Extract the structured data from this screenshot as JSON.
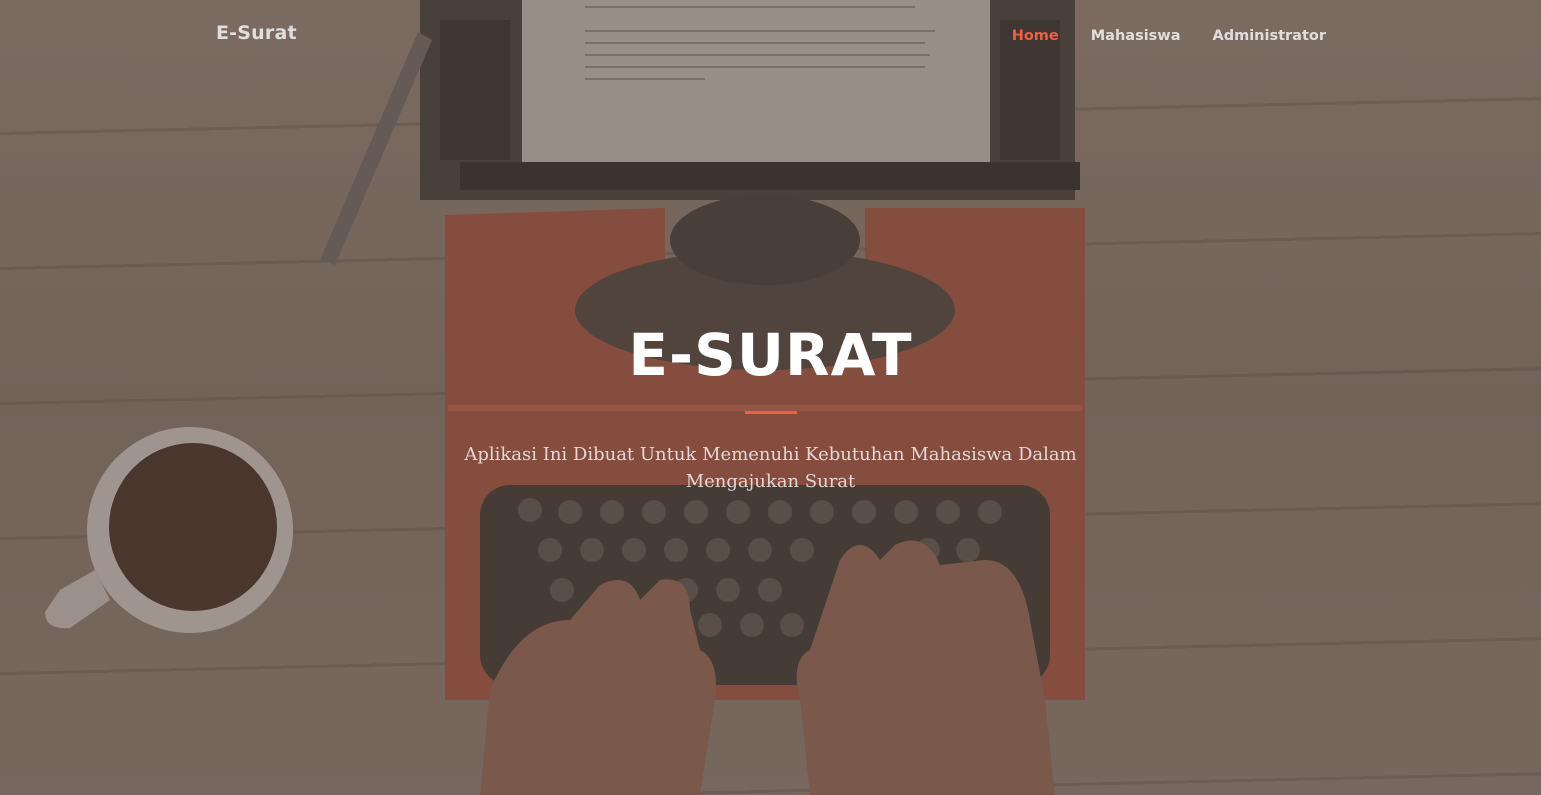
{
  "navbar": {
    "brand": "E-Surat",
    "links": [
      {
        "label": "Home",
        "active": true
      },
      {
        "label": "Mahasiswa",
        "active": false
      },
      {
        "label": "Administrator",
        "active": false
      }
    ]
  },
  "hero": {
    "title": "E-SURAT",
    "subtitle": "Aplikasi Ini Dibuat Untuk Memenuhi Kebutuhan Mahasiswa Dalam Mengajukan Surat"
  },
  "colors": {
    "accent": "#f05f40",
    "overlay": "#5c4d42"
  }
}
